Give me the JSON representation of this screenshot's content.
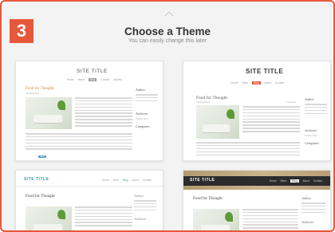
{
  "step": "3",
  "dialog": {
    "title": "Choose a Theme",
    "subtitle": "You can easily change this later"
  },
  "colors": {
    "accent": "#e8573a",
    "teal": "#2aa5a0",
    "tan": "#b39a73"
  },
  "themes": [
    {
      "site_title": "SITE TITLE",
      "nav": [
        "Home",
        "About",
        "Blog",
        "Contact",
        "Archive"
      ],
      "post_title": "Food for Thought",
      "post_meta": "Uncategorized",
      "sidebar": [
        "Author",
        "Archives",
        "Categories"
      ],
      "archive_item": "October 2013"
    },
    {
      "site_title": "SITE TITLE",
      "nav": [
        "Home",
        "Store",
        "Blog",
        "About",
        "Contact"
      ],
      "post_title": "Food for Thought",
      "post_meta": "Uncategorized",
      "comments": "1 Comment",
      "sidebar": [
        "Author",
        "Archives",
        "Categories"
      ],
      "archive_item": "October 2013"
    },
    {
      "site_title": "SITE TITLE",
      "nav": [
        "Home",
        "Store",
        "Blog",
        "About",
        "Contact"
      ],
      "post_title": "Food for Thought",
      "sidebar": [
        "Author",
        "Archives"
      ]
    },
    {
      "site_title": "SITE TITLE",
      "nav": [
        "Home",
        "Store",
        "Blog",
        "About",
        "Contact"
      ],
      "post_title": "Food for Thought",
      "sidebar": [
        "Author",
        "Archives"
      ]
    }
  ]
}
